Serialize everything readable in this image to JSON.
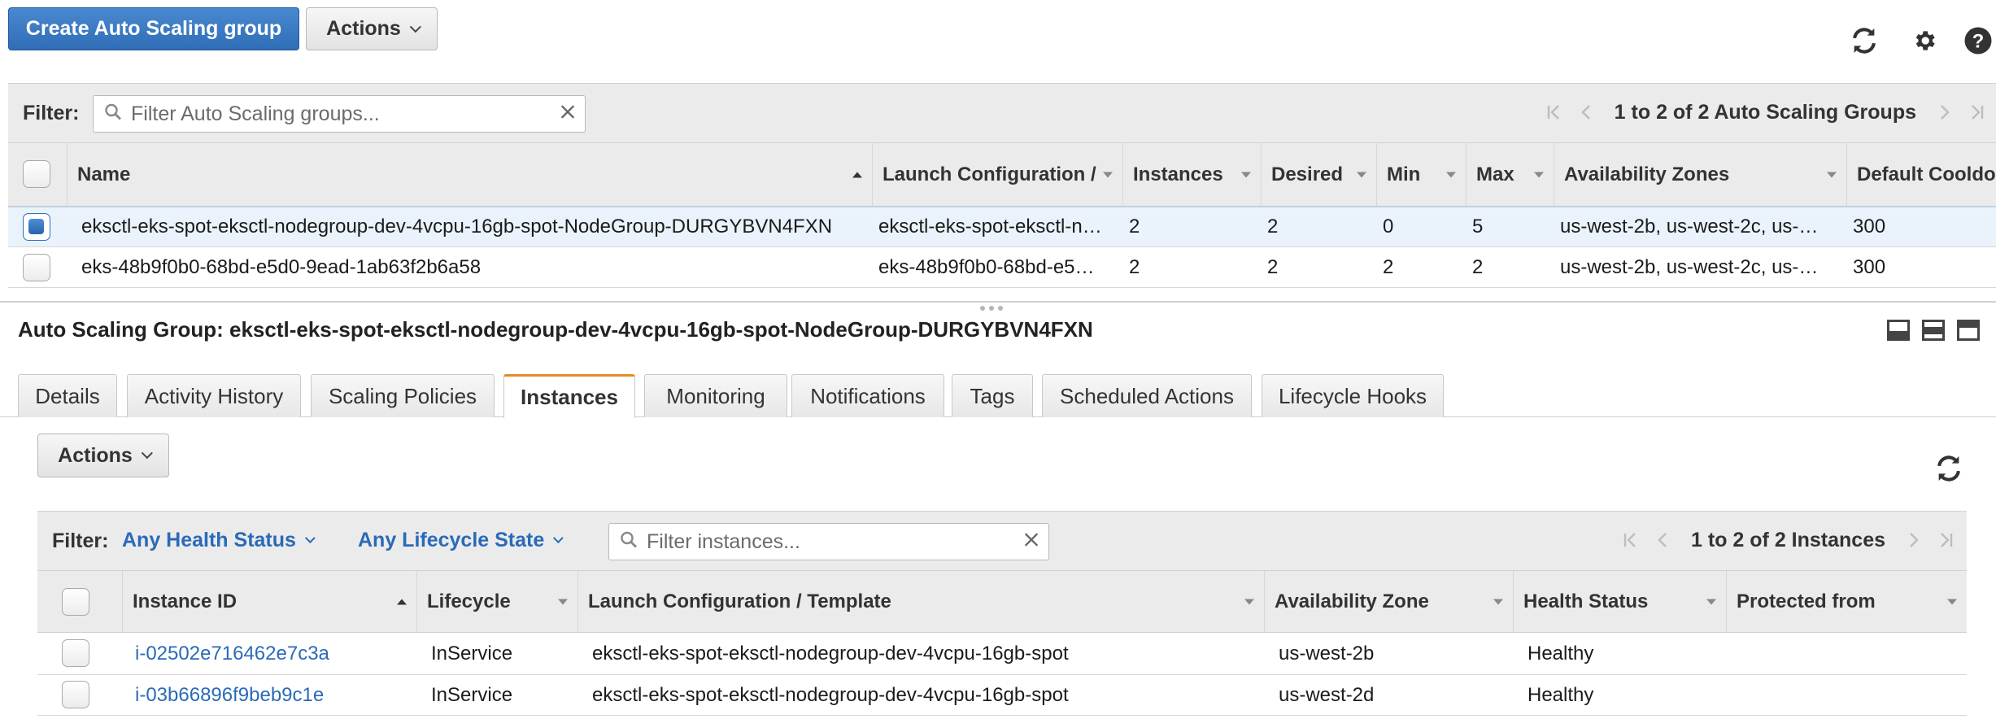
{
  "toolbar": {
    "create_label": "Create Auto Scaling group",
    "actions_label": "Actions",
    "icons": [
      "refresh-icon",
      "gear-icon",
      "help-icon"
    ]
  },
  "asg_filter": {
    "label": "Filter:",
    "placeholder": "Filter Auto Scaling groups...",
    "pager_text": "1 to 2 of 2 Auto Scaling Groups"
  },
  "asg_table": {
    "columns": [
      "Name",
      "Launch Configuration /",
      "Instances",
      "Desired",
      "Min",
      "Max",
      "Availability Zones",
      "Default Cooldo"
    ],
    "rows": [
      {
        "selected": true,
        "name": "eksctl-eks-spot-eksctl-nodegroup-dev-4vcpu-16gb-spot-NodeGroup-DURGYBVN4FXN",
        "launch": "eksctl-eks-spot-eksctl-n…",
        "instances": "2",
        "desired": "2",
        "min": "0",
        "max": "5",
        "zones": "us-west-2b, us-west-2c, us-…",
        "cooldown": "300"
      },
      {
        "selected": false,
        "name": "eks-48b9f0b0-68bd-e5d0-9ead-1ab63f2b6a58",
        "launch": "eks-48b9f0b0-68bd-e5…",
        "instances": "2",
        "desired": "2",
        "min": "2",
        "max": "2",
        "zones": "us-west-2b, us-west-2c, us-…",
        "cooldown": "300"
      }
    ]
  },
  "detail": {
    "title": "Auto Scaling Group: eksctl-eks-spot-eksctl-nodegroup-dev-4vcpu-16gb-spot-NodeGroup-DURGYBVN4FXN",
    "tabs": [
      "Details",
      "Activity History",
      "Scaling Policies",
      "Instances",
      "Monitoring",
      "Notifications",
      "Tags",
      "Scheduled Actions",
      "Lifecycle Hooks"
    ],
    "active_tab": "Instances",
    "actions_label": "Actions"
  },
  "instance_filter": {
    "label": "Filter:",
    "health_label": "Any Health Status",
    "lifecycle_label": "Any Lifecycle State",
    "placeholder": "Filter instances...",
    "pager_text": "1 to 2 of 2 Instances"
  },
  "instance_table": {
    "columns": [
      "Instance ID",
      "Lifecycle",
      "Launch Configuration / Template",
      "Availability Zone",
      "Health Status",
      "Protected from"
    ],
    "rows": [
      {
        "id": "i-02502e716462e7c3a",
        "lifecycle": "InService",
        "launch": "eksctl-eks-spot-eksctl-nodegroup-dev-4vcpu-16gb-spot",
        "zone": "us-west-2b",
        "health": "Healthy",
        "protected": ""
      },
      {
        "id": "i-03b66896f9beb9c1e",
        "lifecycle": "InService",
        "launch": "eksctl-eks-spot-eksctl-nodegroup-dev-4vcpu-16gb-spot",
        "zone": "us-west-2d",
        "health": "Healthy",
        "protected": ""
      }
    ]
  }
}
